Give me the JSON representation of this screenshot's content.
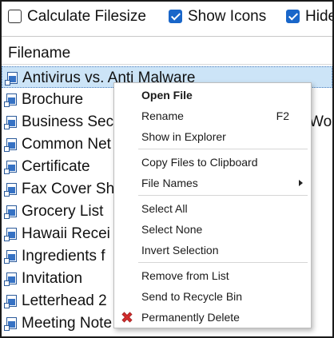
{
  "options": {
    "calculate_filesize": {
      "label": "Calculate Filesize",
      "checked": false
    },
    "show_icons": {
      "label": "Show Icons",
      "checked": true
    },
    "hide": {
      "label": "Hide",
      "checked": true
    }
  },
  "list_header": {
    "title": "Filename"
  },
  "files": [
    {
      "name": "Antivirus vs. Anti Malware",
      "selected": true
    },
    {
      "name": "Brochure"
    },
    {
      "name": "Business Sec"
    },
    {
      "name": "Common Net"
    },
    {
      "name": "Certificate"
    },
    {
      "name": "Fax Cover Sh"
    },
    {
      "name": "Grocery List"
    },
    {
      "name": "Hawaii Recei"
    },
    {
      "name": "Ingredients f"
    },
    {
      "name": "Invitation"
    },
    {
      "name": "Letterhead 2"
    },
    {
      "name": "Meeting Note"
    }
  ],
  "partial_text": {
    "business_row_suffix": "Work"
  },
  "context_menu": {
    "open_file": "Open File",
    "rename": "Rename",
    "rename_shortcut": "F2",
    "show_in_explorer": "Show in Explorer",
    "copy_files": "Copy Files to Clipboard",
    "file_names": "File Names",
    "select_all": "Select All",
    "select_none": "Select None",
    "invert_selection": "Invert Selection",
    "remove_from_list": "Remove from List",
    "send_to_recycle_bin": "Send to Recycle Bin",
    "permanently_delete": "Permanently Delete"
  },
  "colors": {
    "accent": "#1966c9",
    "selection_background": "#cce4f7",
    "delete_icon": "#d22c2c"
  },
  "icons": {
    "file_icon": "document-shortcut-icon",
    "submenu_arrow": "chevron-right-icon",
    "delete_icon": "red-x-icon"
  }
}
